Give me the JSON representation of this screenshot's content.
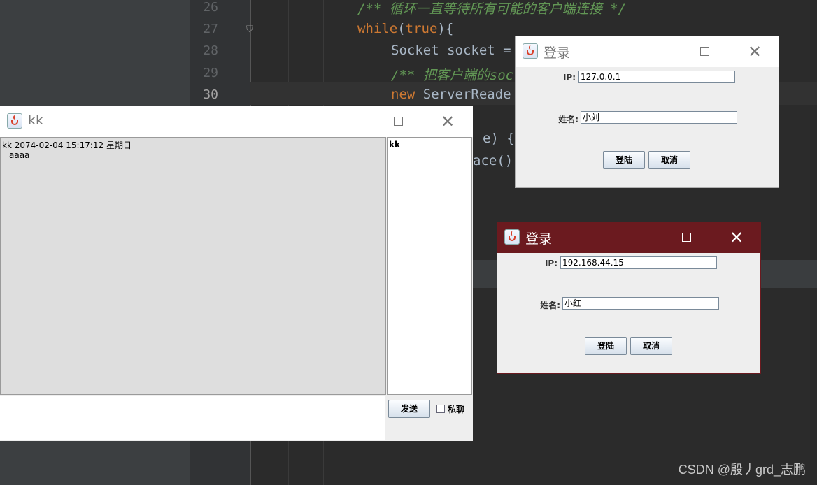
{
  "ide": {
    "line_numbers": [
      "26",
      "27",
      "28",
      "29",
      "30"
    ],
    "lines": {
      "l26_comment": "/** 循环一直等待所有可能的客户端连接 */",
      "l27_kw": "while",
      "l27_rest": "(",
      "l27_true": "true",
      "l27_end": "){",
      "l28_text": "Socket socket =",
      "l29_comment": "/** 把客户端的soc",
      "l30_kw": "new",
      "l30_rest": " ServerReade",
      "l31_text": "e) {",
      "l32_text": "ace()"
    },
    "watermark": "CSDN @殷丿grd_志鹏"
  },
  "chat_window": {
    "title": "kk",
    "message_header": "kk  2074-02-04 15:17:12 星期日",
    "message_body": "aaaa",
    "users": [
      "kk"
    ],
    "send_label": "发送",
    "private_label": "私聊",
    "private_checked": false
  },
  "login1": {
    "title": "登录",
    "ip_label": "IP:",
    "ip_value": "127.0.0.1",
    "name_label": "姓名:",
    "name_value": "小刘",
    "login_label": "登陆",
    "cancel_label": "取消"
  },
  "login2": {
    "title": "登录",
    "ip_label": "IP:",
    "ip_value": "192.168.44.15",
    "name_label": "姓名:",
    "name_value": "小红",
    "login_label": "登陆",
    "cancel_label": "取消"
  },
  "colors": {
    "active_titlebar": "#6b1a1f",
    "ide_background": "#2b2b2b",
    "keyword": "#cc7832",
    "comment": "#629755"
  }
}
